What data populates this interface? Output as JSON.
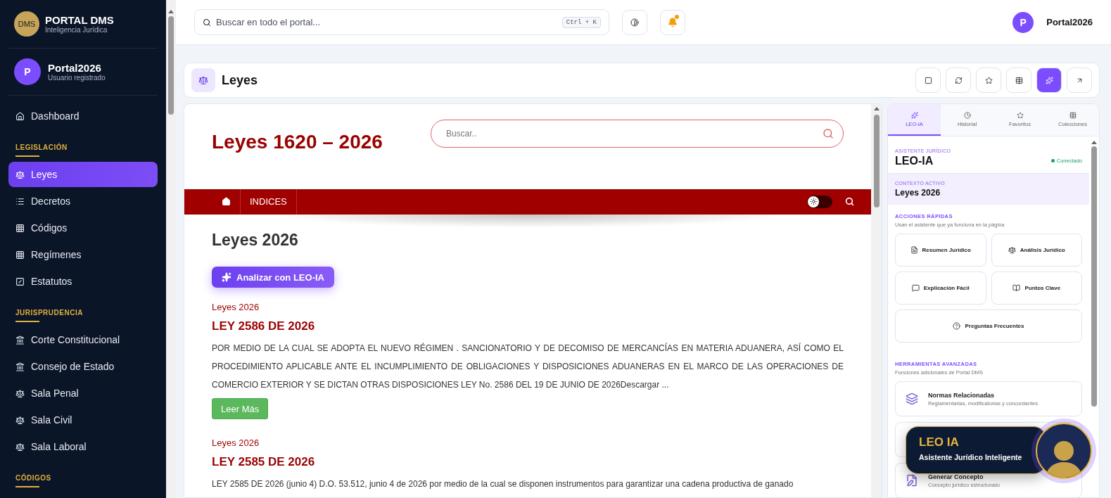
{
  "sidebar": {
    "brand": {
      "logo": "DMS",
      "title": "PORTAL DMS",
      "subtitle": "Inteligencia Jurídica"
    },
    "user": {
      "initial": "P",
      "name": "Portal2026",
      "role": "Usuario registrado"
    },
    "nav": [
      {
        "kind": "link",
        "label": "Dashboard",
        "selected": false
      },
      {
        "kind": "section",
        "label": "LEGISLACIÓN"
      },
      {
        "kind": "link",
        "label": "Leyes",
        "selected": true
      },
      {
        "kind": "link",
        "label": "Decretos",
        "selected": false
      },
      {
        "kind": "link",
        "label": "Códigos",
        "selected": false
      },
      {
        "kind": "link",
        "label": "Regímenes",
        "selected": false
      },
      {
        "kind": "link",
        "label": "Estatutos",
        "selected": false
      },
      {
        "kind": "section",
        "label": "JURISPRUDENCIA"
      },
      {
        "kind": "link",
        "label": "Corte Constitucional",
        "selected": false
      },
      {
        "kind": "link",
        "label": "Consejo de Estado",
        "selected": false
      },
      {
        "kind": "link",
        "label": "Sala Penal",
        "selected": false
      },
      {
        "kind": "link",
        "label": "Sala Civil",
        "selected": false
      },
      {
        "kind": "link",
        "label": "Sala Laboral",
        "selected": false
      },
      {
        "kind": "section",
        "label": "CÓDIGOS"
      }
    ]
  },
  "topbar": {
    "search": {
      "placeholder": "Buscar en todo el portal...",
      "shortcut": "Ctrl + K"
    },
    "notification": true,
    "user": {
      "initial": "P",
      "name": "Portal2026"
    }
  },
  "header": {
    "title": "Leyes",
    "tools": [
      {
        "selected": false
      },
      {
        "selected": false
      },
      {
        "selected": false
      },
      {
        "selected": false
      },
      {
        "selected": true
      },
      {
        "selected": false
      }
    ]
  },
  "content": {
    "title": "Leyes 1620 – 2026",
    "search": {
      "placeholder": "Buscar.."
    },
    "menu": {
      "label": "INDICES",
      "dark_mode": false
    },
    "heading": "Leyes 2026",
    "analyze_button": "Analizar con LEO-IA",
    "articles": [
      {
        "category": "Leyes 2026",
        "title": "LEY 2586 DE 2026",
        "body": "POR MEDIO DE LA CUAL SE ADOPTA EL NUEVO RÉGIMEN . SANCIONATORIO Y DE DECOMISO DE MERCANCÍAS EN MATERIA ADUANERA, ASÍ COMO EL PROCEDIMIENTO APLICABLE ANTE EL INCUMPLIMIENTO DE OBLIGACIONES Y DISPOSICIONES ADUANERAS EN EL MARCO DE LAS OPERACIONES DE COMERCIO EXTERIOR Y SE DICTAN OTRAS DISPOSICIONES LEY No. 2586 DEL 19 DE JUNIO DE 2026Descargar ...",
        "button": "Leer Más"
      },
      {
        "category": "Leyes 2026",
        "title": "LEY 2585 DE 2026",
        "body": "LEY 2585 DE 2026 (junio 4) D.O. 53.512, junio 4 de 2026 por medio de la cual se disponen instrumentos para garantizar una cadena productiva de ganado"
      }
    ]
  },
  "assistant": {
    "tabs": [
      {
        "label": "LEO-IA",
        "selected": true
      },
      {
        "label": "Historial",
        "selected": false
      },
      {
        "label": "Favoritos",
        "selected": false
      },
      {
        "label": "Colecciones",
        "selected": false
      }
    ],
    "eyebrow": "ASISTENTE JURÍDICO",
    "name": "LEO-IA",
    "status": "Conectado",
    "context": {
      "label": "CONTEXTO ACTIVO",
      "value": "Leyes 2026"
    },
    "quick": {
      "title": "ACCIONES RÁPIDAS",
      "subtitle": "Usan el asistente que ya funciona en la página",
      "actions": [
        "Resumen Jurídico",
        "Análisis Jurídico",
        "Explicación Fácil",
        "Puntos Clave",
        "Preguntas Frecuentes"
      ]
    },
    "advanced": {
      "title": "HERRAMIENTAS AVANZADAS",
      "subtitle": "Funciones adicionales de Portal DMS",
      "tools": [
        {
          "title": "Normas Relacionadas",
          "subtitle": "Reglamentarias, modificatorias y concordantes"
        },
        {
          "title": "Generar Concepto",
          "subtitle": "Concepto jurídico estructurado"
        }
      ]
    }
  },
  "widget": {
    "title": "LEO IA",
    "subtitle": "Asistente Jurídico Inteligente"
  }
}
